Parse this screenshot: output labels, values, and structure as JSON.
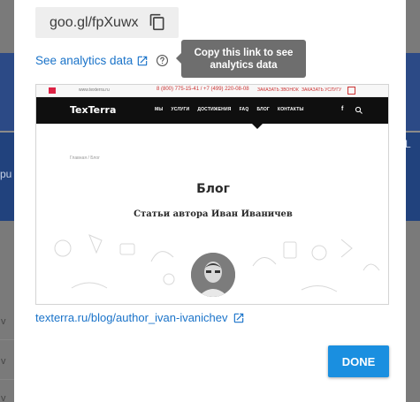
{
  "background": {
    "left_text_1": "pu",
    "right_text": "L",
    "row_snippets": [
      "v",
      "v",
      "v"
    ]
  },
  "dialog": {
    "short_url": "goo.gl/fpXuwx",
    "copy_icon": "copy-icon",
    "analytics_link_label": "See analytics data",
    "external_link_icon": "open-in-new-icon",
    "help_icon": "help-circle-icon",
    "tooltip_text": "Copy this link to see analytics data",
    "full_url": "texterra.ru/blog/author_ivan-ivanichev",
    "done_label": "DONE"
  },
  "preview": {
    "site_small": "www.texterra.ru",
    "phone": "8 (800) 775-15-41  /  +7 (499) 220-08-08",
    "callback_1": "ЗАКАЗАТЬ ЗВОНОК",
    "callback_2": "ЗАКАЗАТЬ УСЛУГУ",
    "brand": "TexTerra",
    "menu": [
      "МЫ",
      "УСЛУГИ",
      "ДОСТИЖЕНИЯ",
      "FAQ",
      "БЛОГ",
      "КОНТАКТЫ"
    ],
    "social": "f",
    "breadcrumb": "Главная  /  Блог",
    "title": "Блог",
    "subtitle": "Статьи автора Иван Иваничев"
  },
  "colors": {
    "accent": "#1a8fe0",
    "link": "#1a73c9",
    "tooltip_bg": "#6e6e6e"
  }
}
